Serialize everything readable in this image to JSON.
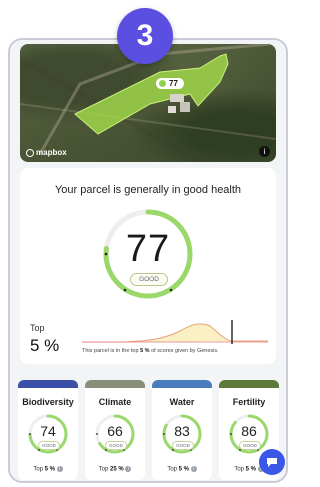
{
  "step": "3",
  "map": {
    "parcel_score": "77",
    "attribution": "mapbox",
    "info_glyph": "i",
    "polygon_color": "#9fd64a"
  },
  "health": {
    "title": "Your parcel is generally in good health",
    "score": "77",
    "score_fraction": 0.77,
    "status": "GOOD",
    "top_label": "Top",
    "top_pct": "5 %",
    "note_prefix": "This parcel is in the top ",
    "note_pct": "5 %",
    "note_suffix": " of scores given by Genesis."
  },
  "metrics": [
    {
      "name": "Biodiversity",
      "value": "74",
      "fraction": 0.74,
      "status": "GOOD",
      "top_prefix": "Top ",
      "top_pct": "5 %",
      "banner": "#3b4fa8"
    },
    {
      "name": "Climate",
      "value": "66",
      "fraction": 0.66,
      "status": "GOOD",
      "top_prefix": "Top ",
      "top_pct": "25 %",
      "banner": "#8a8f7a"
    },
    {
      "name": "Water",
      "value": "83",
      "fraction": 0.83,
      "status": "GOOD",
      "top_prefix": "Top ",
      "top_pct": "5 %",
      "banner": "#4a7cc0"
    },
    {
      "name": "Fertility",
      "value": "86",
      "fraction": 0.86,
      "status": "GOOD",
      "top_prefix": "Top ",
      "top_pct": "5 %",
      "banner": "#5e7a3a"
    }
  ],
  "colors": {
    "accent": "#5a4fe0",
    "gauge_green": "#9ad86b",
    "chat": "#3a57e8"
  },
  "icons": [
    "info-icon",
    "chat-icon",
    "mapbox-logo-icon"
  ]
}
